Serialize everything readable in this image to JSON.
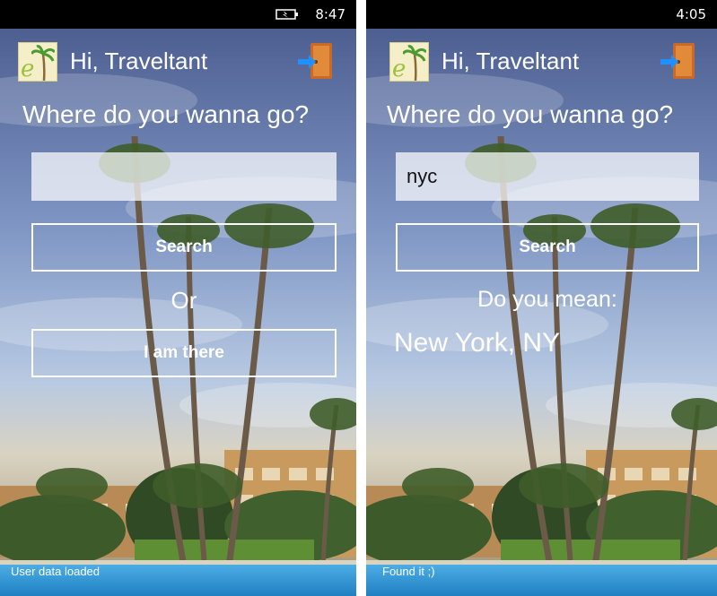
{
  "left_screen": {
    "status_bar": {
      "time": "8:47"
    },
    "header": {
      "greeting": "Hi, Traveltant"
    },
    "prompt": "Where do you wanna go?",
    "search_input": {
      "value": "",
      "placeholder": ""
    },
    "search_button_label": "Search",
    "or_label": "Or",
    "here_button_label": "I am there",
    "status_message": "User data loaded"
  },
  "right_screen": {
    "status_bar": {
      "time": "4:05"
    },
    "header": {
      "greeting": "Hi, Traveltant"
    },
    "prompt": "Where do you wanna go?",
    "search_input": {
      "value": "nyc",
      "placeholder": ""
    },
    "search_button_label": "Search",
    "did_you_mean_label": "Do you mean:",
    "suggestion": "New York, NY",
    "status_message": "Found it ;)"
  },
  "icons": {
    "app_logo": "palm-tree-logo-icon",
    "logout": "door-exit-icon",
    "battery": "battery-charging-icon"
  },
  "colors": {
    "sky_top": "#5d6f9e",
    "sky_mid": "#9bb4d8",
    "pool": "#3a9bd8",
    "text": "#ffffff"
  }
}
